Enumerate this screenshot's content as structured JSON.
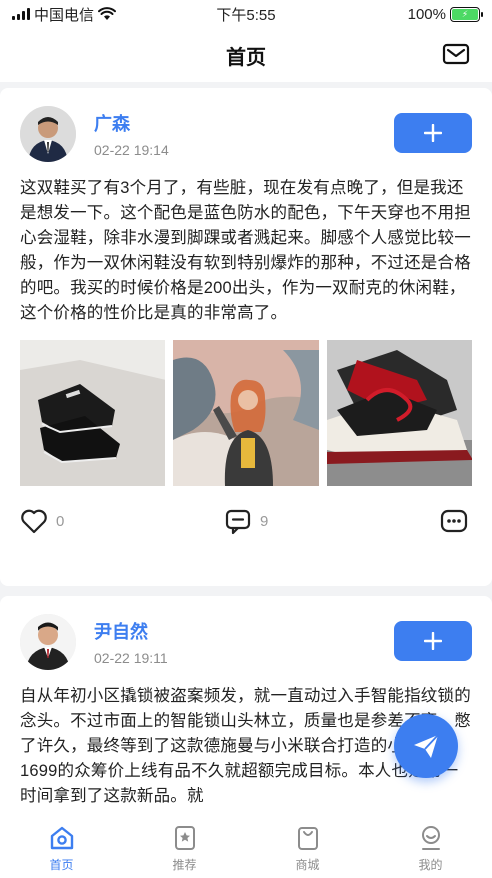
{
  "status": {
    "carrier": "中国电信",
    "time": "下午5:55",
    "battery": "100%"
  },
  "nav": {
    "title": "首页",
    "mail_icon": "mail-icon"
  },
  "posts": [
    {
      "user": "广森",
      "time": "02-22 19:14",
      "text": "这双鞋买了有3个月了，有些脏，现在发有点晚了，但是我还是想发一下。这个配色是蓝色防水的配色，下午天穿也不用担心会湿鞋，除非水漫到脚踝或者溅起来。脚感个人感觉比较一般，作为一双休闲鞋没有软到特别爆炸的那种，不过还是合格的吧。我买的时候价格是200出头，作为一双耐克的休闲鞋，这个价格的性价比是真的非常高了。",
      "likes": "0",
      "comments": "9"
    },
    {
      "user": "尹自然",
      "time": "02-22 19:11",
      "text": "自从年初小区撬锁被盗案频发，就一直动过入手智能指纹锁的念头。不过市面上的智能锁山头林立，质量也是参差不齐。憋了许久，最终等到了这款德施曼与小米联合打造的小嘀Q3。1699的众筹价上线有品不久就超额完成目标。本人也是第一时间拿到了这款新品。就"
    }
  ],
  "tabs": [
    {
      "label": "首页",
      "icon": "home-icon",
      "active": true
    },
    {
      "label": "推荐",
      "icon": "star-bookmark-icon"
    },
    {
      "label": "商城",
      "icon": "shopping-bag-icon"
    },
    {
      "label": "我的",
      "icon": "user-icon"
    }
  ],
  "colors": {
    "accent": "#3d7ef0",
    "background": "#f2f3f5"
  }
}
